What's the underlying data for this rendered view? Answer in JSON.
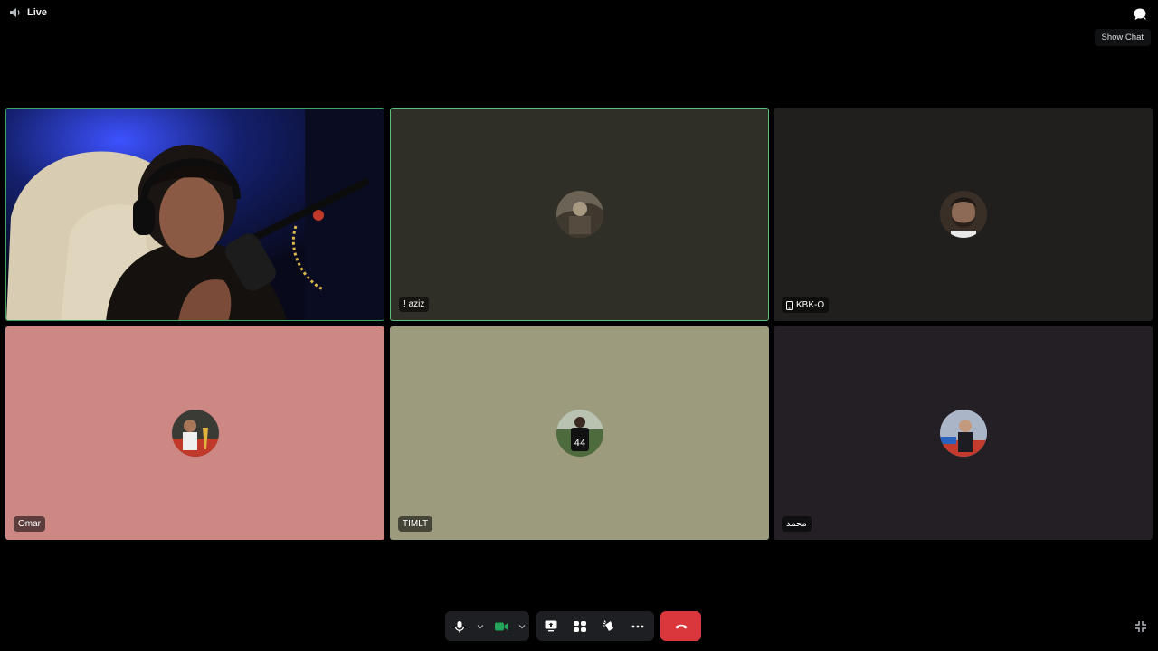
{
  "topbar": {
    "live_label": "Live",
    "chat_tooltip": "Show Chat"
  },
  "tiles": [
    {
      "name": "",
      "type": "video"
    },
    {
      "name": "! aziz",
      "speaking": true,
      "bg": "#2f2e27"
    },
    {
      "name": "KBK-O",
      "mobile": true,
      "bg": "#201f1d"
    },
    {
      "name": "Omar",
      "bg": "#cd8883"
    },
    {
      "name": "TIMLT",
      "bg": "#9c9b7d"
    },
    {
      "name": "محمد",
      "bg": "#231f25"
    }
  ],
  "controls": {
    "icons": [
      "microphone-icon",
      "camera-icon",
      "screen-share-icon",
      "activities-icon",
      "soundboard-icon",
      "more-icon",
      "hang-up-icon"
    ],
    "accent_camera": "#23a55a",
    "hangup_color": "#da373c"
  }
}
